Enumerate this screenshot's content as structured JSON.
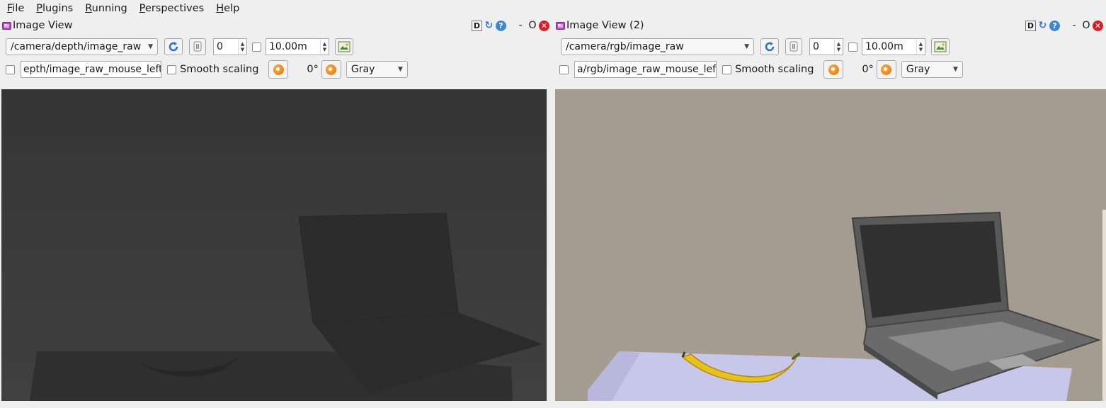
{
  "menubar": {
    "items": [
      {
        "label": "File",
        "ul": "F",
        "rest": "ile"
      },
      {
        "label": "Plugins",
        "ul": "P",
        "rest": "lugins"
      },
      {
        "label": "Running",
        "ul": "R",
        "rest": "unning"
      },
      {
        "label": "Perspectives",
        "ul": "P",
        "rest": "erspectives"
      },
      {
        "label": "Help",
        "ul": "H",
        "rest": "elp"
      }
    ]
  },
  "panels": [
    {
      "title": "Image View",
      "topic": "/camera/depth/image_raw",
      "spin_value": "0",
      "range_value": "10.00m",
      "mouse_topic": "epth/image_raw_mouse_left",
      "smooth_label": "Smooth scaling",
      "rotation": "0°",
      "colormap": "Gray"
    },
    {
      "title": "Image View (2)",
      "topic": "/camera/rgb/image_raw",
      "spin_value": "0",
      "range_value": "10.00m",
      "mouse_topic": "a/rgb/image_raw_mouse_left",
      "smooth_label": "Smooth scaling",
      "rotation": "0°",
      "colormap": "Gray"
    }
  ],
  "window_controls": {
    "d": "D",
    "min": "-",
    "float": "O"
  },
  "colors": {
    "depth_bg": "#3b3b3b",
    "rgb_wall": "#a49c91",
    "rgb_table": "#c7c7ea",
    "banana": "#e8c21c",
    "laptop": "#585858"
  },
  "icons": {
    "refresh": "refresh-icon",
    "pause": "pause-icon",
    "save": "save-image-icon",
    "rotate_left": "rotate-left-icon",
    "rotate_right": "rotate-right-icon",
    "close": "close-icon",
    "help": "help-icon"
  }
}
